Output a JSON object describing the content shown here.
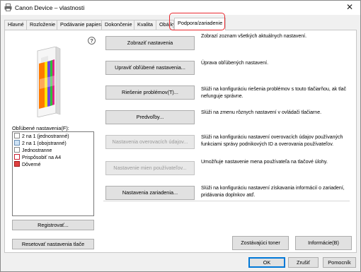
{
  "window": {
    "title": "Canon Device – vlastnosti"
  },
  "tabs": [
    "Hlavné",
    "Rozloženie",
    "Podávanie papiera",
    "Dokončenie",
    "Kvalita",
    "Obálky",
    "Podpora/zariadenie"
  ],
  "active_tab": "Podpora/zariadenie",
  "favorites": {
    "label": "Obľúbené nastavenia(F):",
    "items": [
      "2 na 1 (jednostranné)",
      "2 na 1 (obojstranné)",
      "Jednostranne",
      "Prispôsobiť na A4",
      "Dôverné"
    ],
    "register_button": "Registrovať...",
    "reset_button": "Resetovať nastavenia tlače"
  },
  "actions": [
    {
      "label": "Zobraziť nastavenia",
      "description": "Zobrazí zoznam všetkých aktuálnych nastavení.",
      "enabled": true
    },
    {
      "label": "Upraviť obľúbené nastavenia...",
      "description": "Úprava obľúbených nastavení.",
      "enabled": true
    },
    {
      "label": "Riešenie problémov(T)...",
      "description": "Slúži na konfiguráciu riešenia problémov s touto tlačiarňou, ak tlač nefunguje správne.",
      "enabled": true
    },
    {
      "label": "Predvoľby...",
      "description": "Slúži na zmenu rôznych nastavení v ovládači tlačiarne.",
      "enabled": true
    },
    {
      "label": "Nastavenia overovacích údajov...",
      "description": "Slúži na konfiguráciu nastavení overovacích údajov používaných funkciami správy podnikových ID a overovania používateľov.",
      "enabled": false
    },
    {
      "label": "Nastavenie mien používateľov...",
      "description": "Umožňuje nastavenie mena používateľa na tlačové úlohy.",
      "enabled": false
    },
    {
      "label": "Nastavenia zariadenia...",
      "description": "Slúži na konfiguráciu nastavení získavania informácií o zariadení, pridávania doplnkov atď.",
      "enabled": true
    }
  ],
  "panel_buttons": {
    "toner": "Zostávajúci toner",
    "info": "Informácie(B)"
  },
  "dialog_buttons": {
    "ok": "OK",
    "cancel": "Zrušiť",
    "help": "Pomocník"
  },
  "icons": {
    "app": "printer-icon",
    "help": "help-icon",
    "close": "close-icon"
  },
  "colors": {
    "highlight": "#e8272d",
    "default_button_border": "#0078d7"
  }
}
